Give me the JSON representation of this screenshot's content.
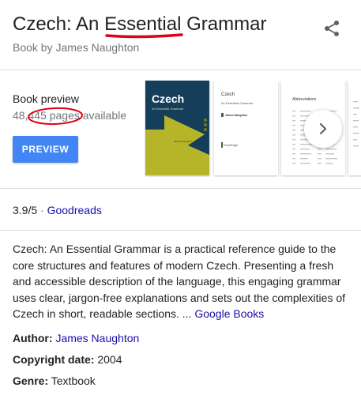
{
  "header": {
    "title": "Czech: An Essential Grammar",
    "subtitle": "Book by James Naughton",
    "share_icon": "share-icon"
  },
  "preview": {
    "label": "Book preview",
    "pages_available": "48,445 pages available",
    "button_label": "PREVIEW",
    "button_color": "#4285f4",
    "next_icon": "chevron-right-icon",
    "pages": [
      {
        "kind": "cover",
        "title": "Czech",
        "subtitle": "An Essential Grammar",
        "author": "James Naughton",
        "colors": [
          "#143e59",
          "#b6b52a"
        ]
      },
      {
        "kind": "title-page",
        "title": "Czech",
        "subtitle": "An Essential Grammar",
        "author": "James Naughton",
        "publisher": "Routledge"
      },
      {
        "kind": "abbreviations",
        "title": "Abbreviations"
      }
    ]
  },
  "rating": {
    "score": "3.9/5",
    "separator": "·",
    "source": "Goodreads"
  },
  "description": {
    "text": "Czech: An Essential Grammar is a practical reference guide to the core structures and features of modern Czech. Presenting a fresh and accessible description of the language, this engaging grammar uses clear, jargon-free explanations and sets out the complexities of Czech in short, readable sections. ...",
    "link": "Google Books"
  },
  "facts": {
    "author_label": "Author:",
    "author_value": "James Naughton",
    "copyright_label": "Copyright date:",
    "copyright_value": "2004",
    "genre_label": "Genre:",
    "genre_value": "Textbook"
  },
  "colors": {
    "link": "#1a0dab",
    "secondary_text": "#70757a",
    "annotation": "#e0001a"
  }
}
